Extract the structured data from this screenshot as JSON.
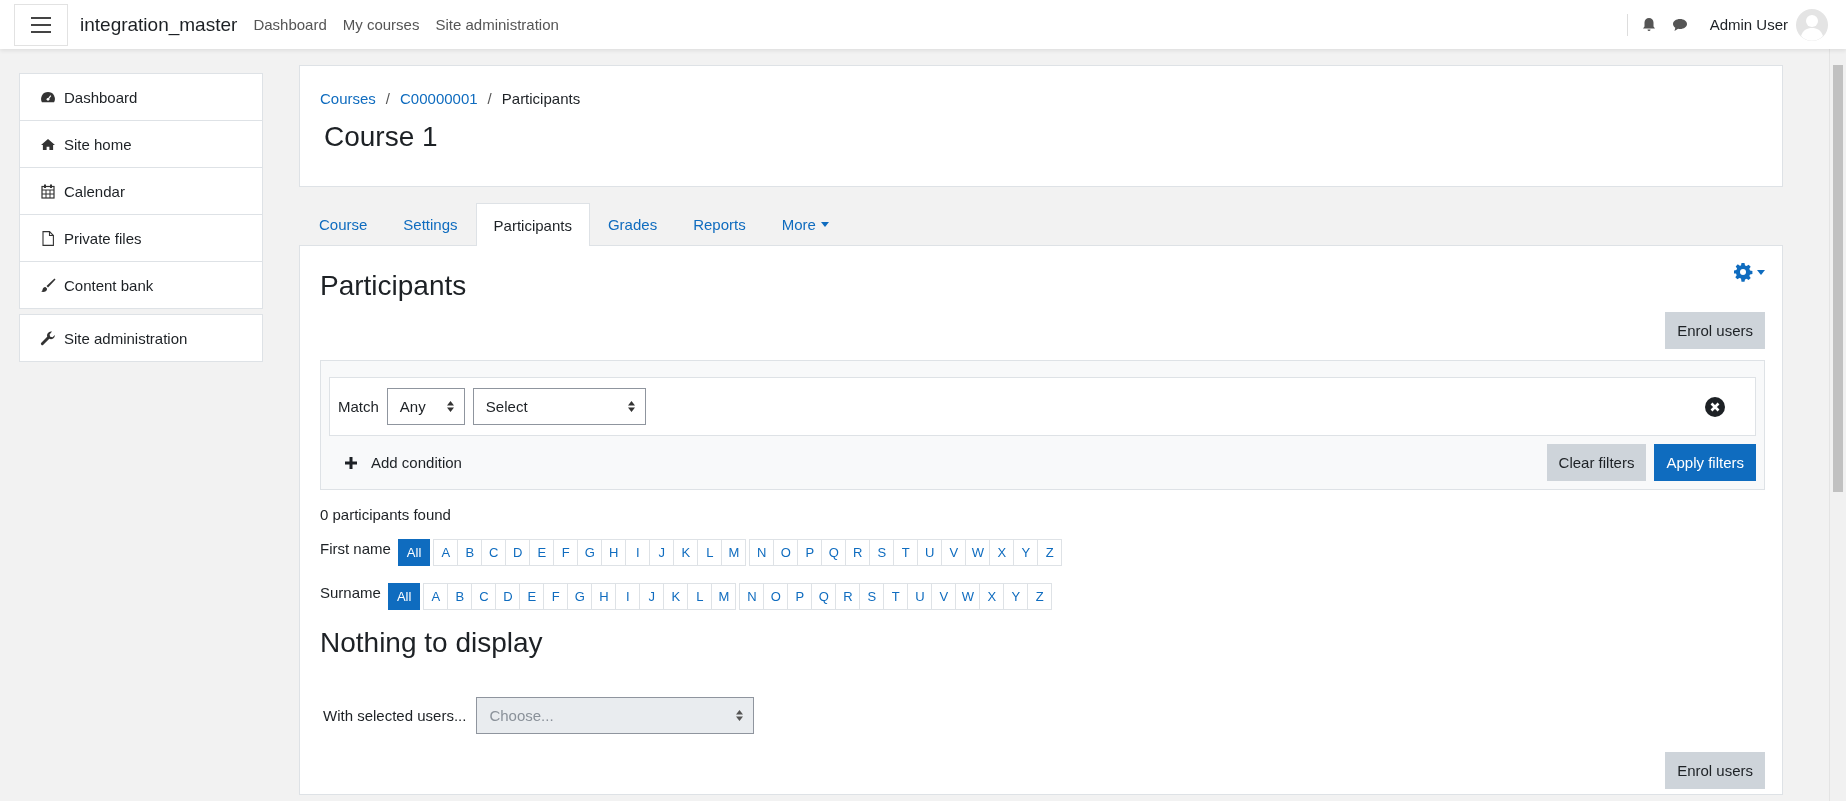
{
  "navbar": {
    "site_name": "integration_master",
    "links": [
      "Dashboard",
      "My courses",
      "Site administration"
    ],
    "user_name": "Admin User"
  },
  "sidebar": {
    "groups": [
      [
        {
          "label": "Dashboard",
          "kind": "dashboard"
        },
        {
          "label": "Site home",
          "kind": "home"
        },
        {
          "label": "Calendar",
          "kind": "calendar"
        },
        {
          "label": "Private files",
          "kind": "file"
        },
        {
          "label": "Content bank",
          "kind": "brush"
        }
      ],
      [
        {
          "label": "Site administration",
          "kind": "wrench"
        }
      ]
    ]
  },
  "breadcrumb": [
    {
      "label": "Courses",
      "link": true
    },
    {
      "separator": "/",
      "label": "C00000001",
      "link": true
    },
    {
      "separator": "/",
      "label": "Participants",
      "link": false
    }
  ],
  "course_title": "Course 1",
  "tabs": [
    {
      "label": "Course",
      "selected": false,
      "dropdown": false
    },
    {
      "label": "Settings",
      "selected": false,
      "dropdown": false
    },
    {
      "label": "Participants",
      "selected": true,
      "dropdown": false
    },
    {
      "label": "Grades",
      "selected": false,
      "dropdown": false
    },
    {
      "label": "Reports",
      "selected": false,
      "dropdown": false
    },
    {
      "label": "More",
      "selected": false,
      "dropdown": true
    }
  ],
  "page_heading": "Participants",
  "enrol_button_top": "Enrol users",
  "filter": {
    "match_label": "Match",
    "match_value": "Any",
    "field_value": "Select",
    "add_condition": "Add condition",
    "clear_button": "Clear filters",
    "apply_button": "Apply filters"
  },
  "count_text": "0 participants found",
  "initials_bars": [
    {
      "label": "First name",
      "groups": [
        [
          {
            "label": "All",
            "selected": true
          }
        ],
        [
          {
            "label": "A",
            "selected": false
          },
          {
            "label": "B",
            "selected": false
          },
          {
            "label": "C",
            "selected": false
          },
          {
            "label": "D",
            "selected": false
          },
          {
            "label": "E",
            "selected": false
          },
          {
            "label": "F",
            "selected": false
          },
          {
            "label": "G",
            "selected": false
          },
          {
            "label": "H",
            "selected": false
          },
          {
            "label": "I",
            "selected": false
          },
          {
            "label": "J",
            "selected": false
          },
          {
            "label": "K",
            "selected": false
          },
          {
            "label": "L",
            "selected": false
          },
          {
            "label": "M",
            "selected": false
          }
        ],
        [
          {
            "label": "N",
            "selected": false
          },
          {
            "label": "O",
            "selected": false
          },
          {
            "label": "P",
            "selected": false
          },
          {
            "label": "Q",
            "selected": false
          },
          {
            "label": "R",
            "selected": false
          },
          {
            "label": "S",
            "selected": false
          },
          {
            "label": "T",
            "selected": false
          },
          {
            "label": "U",
            "selected": false
          },
          {
            "label": "V",
            "selected": false
          },
          {
            "label": "W",
            "selected": false
          },
          {
            "label": "X",
            "selected": false
          },
          {
            "label": "Y",
            "selected": false
          },
          {
            "label": "Z",
            "selected": false
          }
        ]
      ]
    },
    {
      "label": "Surname",
      "groups": [
        [
          {
            "label": "All",
            "selected": true
          }
        ],
        [
          {
            "label": "A",
            "selected": false
          },
          {
            "label": "B",
            "selected": false
          },
          {
            "label": "C",
            "selected": false
          },
          {
            "label": "D",
            "selected": false
          },
          {
            "label": "E",
            "selected": false
          },
          {
            "label": "F",
            "selected": false
          },
          {
            "label": "G",
            "selected": false
          },
          {
            "label": "H",
            "selected": false
          },
          {
            "label": "I",
            "selected": false
          },
          {
            "label": "J",
            "selected": false
          },
          {
            "label": "K",
            "selected": false
          },
          {
            "label": "L",
            "selected": false
          },
          {
            "label": "M",
            "selected": false
          }
        ],
        [
          {
            "label": "N",
            "selected": false
          },
          {
            "label": "O",
            "selected": false
          },
          {
            "label": "P",
            "selected": false
          },
          {
            "label": "Q",
            "selected": false
          },
          {
            "label": "R",
            "selected": false
          },
          {
            "label": "S",
            "selected": false
          },
          {
            "label": "T",
            "selected": false
          },
          {
            "label": "U",
            "selected": false
          },
          {
            "label": "V",
            "selected": false
          },
          {
            "label": "W",
            "selected": false
          },
          {
            "label": "X",
            "selected": false
          },
          {
            "label": "Y",
            "selected": false
          },
          {
            "label": "Z",
            "selected": false
          }
        ]
      ]
    }
  ],
  "empty_heading": "Nothing to display",
  "bulk_action": {
    "label": "With selected users...",
    "value": "Choose...",
    "disabled": true
  },
  "enrol_button_bottom": "Enrol users"
}
